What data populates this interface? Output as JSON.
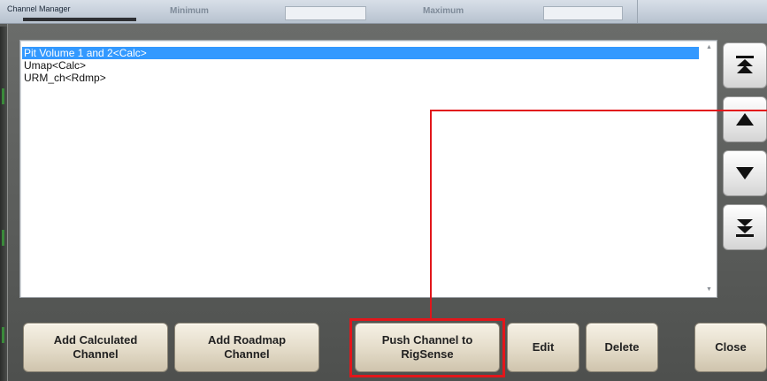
{
  "background_header": {
    "title": "Channel Manager",
    "minimum_label": "Minimum",
    "maximum_label": "Maximum"
  },
  "channel_list": {
    "items": [
      {
        "label": "Pit Volume 1 and 2<Calc>",
        "selected": true
      },
      {
        "label": "Umap<Calc>",
        "selected": false
      },
      {
        "label": "URM_ch<Rdmp>",
        "selected": false
      }
    ]
  },
  "nav_buttons": {
    "move_top": "move-top-icon",
    "move_up": "move-up-icon",
    "move_down": "move-down-icon",
    "move_bottom": "move-bottom-icon"
  },
  "buttons": {
    "add_calculated_line1": "Add Calculated",
    "add_calculated_line2": "Channel",
    "add_roadmap_line1": "Add Roadmap",
    "add_roadmap_line2": "Channel",
    "push_channel_line1": "Push Channel to",
    "push_channel_line2": "RigSense",
    "edit": "Edit",
    "delete": "Delete",
    "close": "Close"
  },
  "colors": {
    "selection": "#3399ff",
    "highlight": "#e2161b",
    "button_face": "#e3dbc8"
  }
}
